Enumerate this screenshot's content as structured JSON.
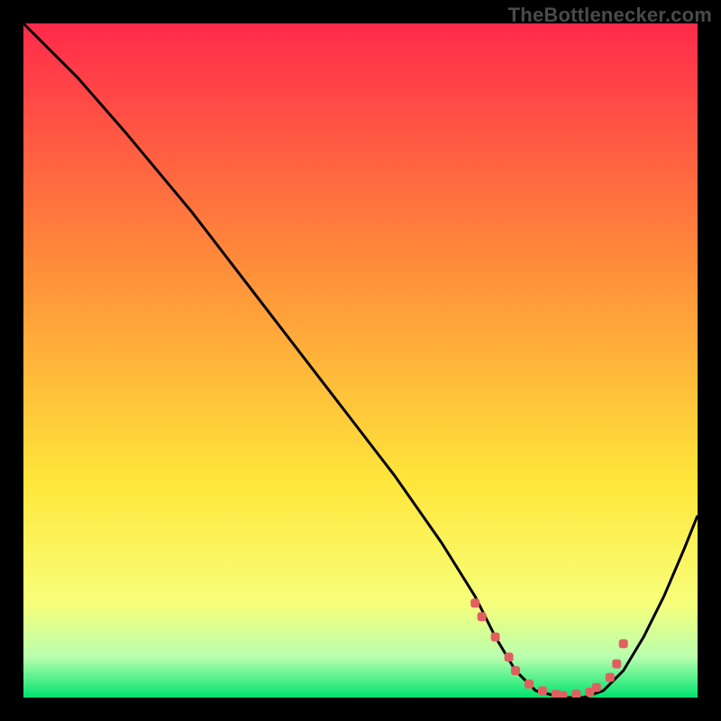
{
  "watermark": "TheBottlenecker.com",
  "colors": {
    "frame": "#000000",
    "gradient_top": "#ff2a4b",
    "gradient_mid_a": "#ff8a3a",
    "gradient_mid_b": "#ffe63a",
    "gradient_low_a": "#f7ff7a",
    "gradient_low_b": "#b8ffae",
    "gradient_bottom": "#00e36e",
    "curve": "#000000",
    "marker": "#e06060"
  },
  "chart_data": {
    "type": "line",
    "title": "",
    "xlabel": "",
    "ylabel": "",
    "xlim": [
      0,
      100
    ],
    "ylim": [
      0,
      100
    ],
    "series": [
      {
        "name": "bottleneck-curve",
        "x": [
          0,
          3,
          8,
          15,
          25,
          35,
          45,
          55,
          62,
          67,
          70,
          73,
          76,
          80,
          83,
          86,
          89,
          92,
          95,
          98,
          100
        ],
        "y": [
          100,
          97,
          92,
          84,
          72,
          59,
          46,
          33,
          23,
          15,
          9,
          4,
          1,
          0,
          0,
          1,
          4,
          9,
          15,
          22,
          27
        ]
      }
    ],
    "markers": {
      "name": "recommended-range",
      "x": [
        67,
        68,
        70,
        72,
        73,
        75,
        77,
        79,
        80,
        82,
        84,
        85,
        87,
        88,
        89
      ],
      "y": [
        14,
        12,
        9,
        6,
        4,
        2,
        1,
        0.5,
        0.3,
        0.5,
        0.8,
        1.5,
        3,
        5,
        8
      ]
    }
  }
}
